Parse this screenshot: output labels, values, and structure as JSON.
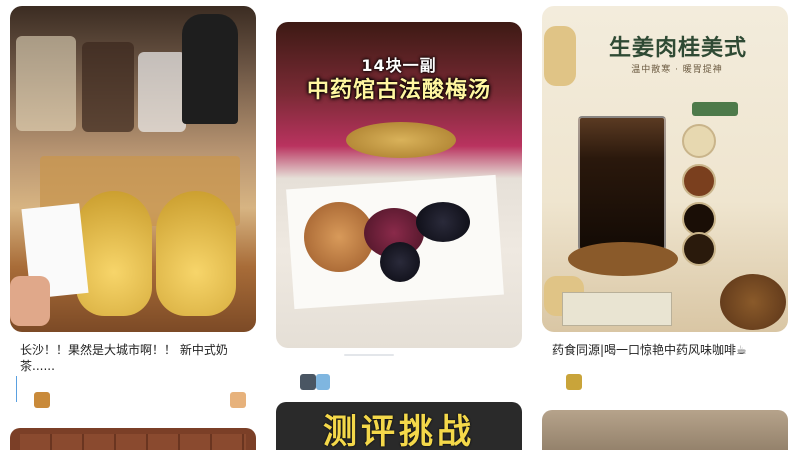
{
  "feed": {
    "cards": [
      {
        "title": "长沙！！果然是大城市啊！！新中式奶茶......",
        "title_line1": "长沙！！果然是大城市啊！！  新中式奶",
        "title_line2": "茶......",
        "avatar_color": "#c98a3a",
        "right_avatar_color": "#e7b27c"
      },
      {
        "price_text": "14块一副",
        "headline": "中药馆古法酸梅汤",
        "avatar_color": "#4a5663"
      },
      {
        "headline": "生姜肉桂美式",
        "subline": "温中散寒 · 暖胃提神",
        "title": "药食同源|喝一口惊艳中药风味咖啡☕",
        "avatar_color": "#c9a43a"
      }
    ],
    "bottom_cards": [
      {
        "image_theme": "brown-chocolate"
      },
      {
        "overlay_text": "测评挑战"
      },
      {
        "image_theme": "interior"
      }
    ]
  }
}
